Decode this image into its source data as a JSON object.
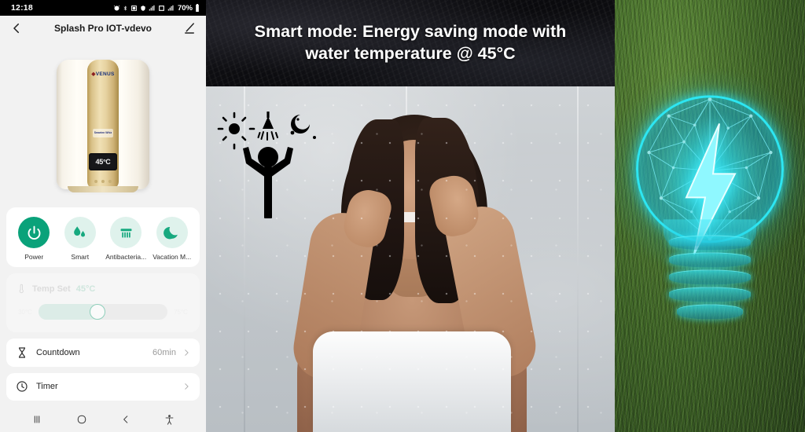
{
  "phone": {
    "status_bar": {
      "clock": "12:18",
      "battery": "70%",
      "icons": [
        "alarm-icon",
        "bluetooth-icon",
        "nfc-icon",
        "vpn-icon",
        "signal-icon",
        "wifi-icon",
        "signal2-icon",
        "battery-icon"
      ]
    },
    "header": {
      "back_icon": "chevron-left-icon",
      "title": "Splash Pro IOT-vdevo",
      "edit_icon": "pencil-icon"
    },
    "heater": {
      "brand": "VENUS",
      "badge": "Smarten Whiz",
      "display_temp": "45°C"
    },
    "modes": [
      {
        "label": "Power",
        "icon": "power-icon",
        "active": true
      },
      {
        "label": "Smart",
        "icon": "water-drops-icon",
        "active": false
      },
      {
        "label": "Antibacteria...",
        "icon": "shower-head-icon",
        "active": false
      },
      {
        "label": "Vacation M...",
        "icon": "moon-icon",
        "active": false
      }
    ],
    "temp_set": {
      "icon": "thermometer-icon",
      "label": "Temp Set",
      "value": "45°C",
      "min_label": "30°C",
      "max_label": "75°C",
      "slider_percent": 46,
      "disabled": true
    },
    "rows": [
      {
        "icon": "hourglass-icon",
        "label": "Countdown",
        "value": "60min",
        "chevron": "chevron-right-icon"
      },
      {
        "icon": "clock-icon",
        "label": "Timer",
        "value": "",
        "chevron": "chevron-right-icon"
      }
    ],
    "nav_bar": [
      {
        "name": "recents-button",
        "icon": "recents-icon"
      },
      {
        "name": "home-button",
        "icon": "home-circle-icon"
      },
      {
        "name": "back-button",
        "icon": "chevron-left-icon"
      },
      {
        "name": "accessibility-button",
        "icon": "accessibility-icon"
      }
    ]
  },
  "smart_panel": {
    "headline_line1": "Smart mode: Energy saving mode with",
    "headline_line2": "water temperature @ 45°C",
    "pictogram": "sun-shower-person-moon-icon",
    "photo_alt": "woman-showering-photo"
  },
  "energy_panel": {
    "graphic": "low-poly-light-bulb-with-lightning-bolt",
    "background": "grass-field"
  },
  "colors": {
    "accent_green": "#0aa27a",
    "accent_green_soft": "#dff2ec",
    "phone_bg": "#f2f2f2",
    "card_bg": "#ffffff",
    "bulb_cyan": "#2de6f2",
    "grass_green": "#3f6527",
    "banner_black": "#0a0a0d"
  }
}
